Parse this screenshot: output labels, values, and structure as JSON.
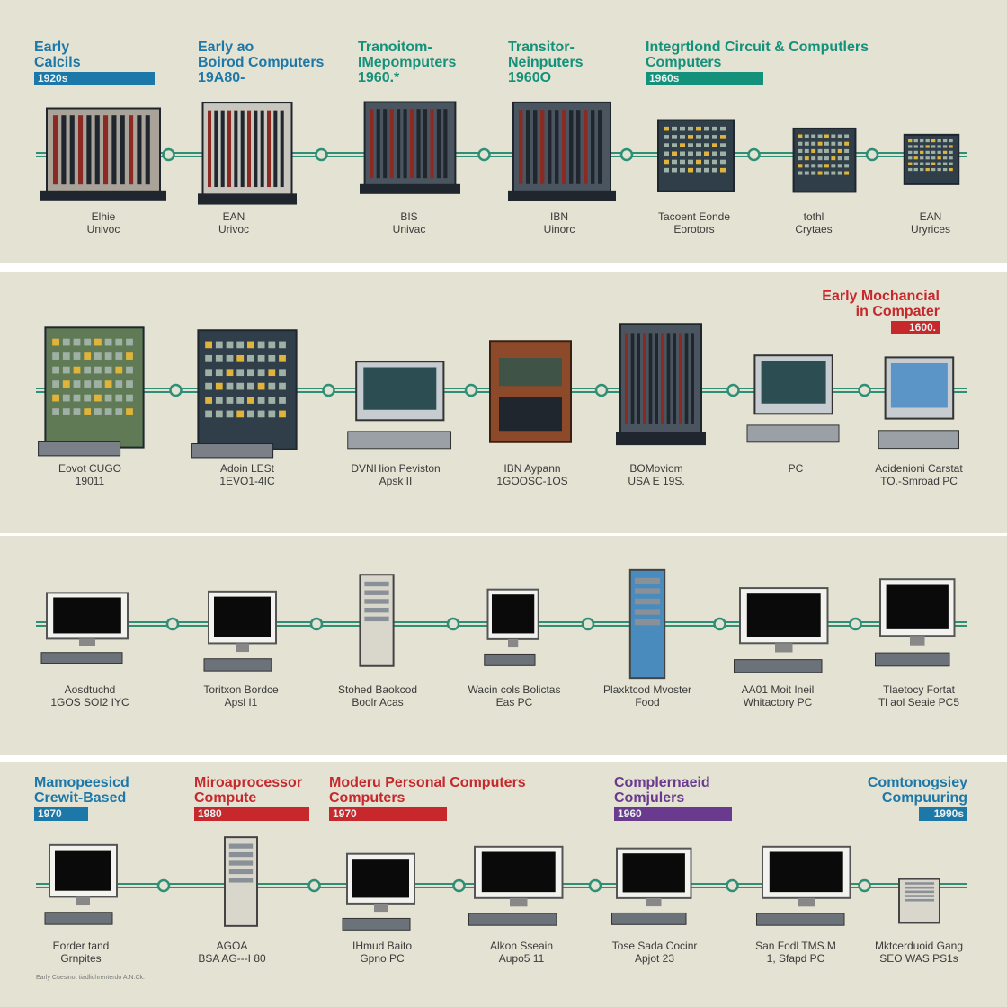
{
  "colors": {
    "background": "#e3e2d3",
    "timeline": "#2f8f76",
    "blue": "#1c78a8",
    "teal": "#14917a",
    "red": "#c6282c",
    "purple": "#6a3a8e"
  },
  "rows": [
    {
      "eras": [
        {
          "title": "Early\nCalcils",
          "badge": "1920s",
          "color": "blue"
        },
        {
          "title": "Early ao\nBoirod Computers\n19A80-",
          "badge": "",
          "color": "blue"
        },
        {
          "title": "Tranoitom-\nIMepomputers\n1960.*",
          "badge": "",
          "color": "teal"
        },
        {
          "title": "Transitor-\nNeinputers\n1960O",
          "badge": "",
          "color": "teal"
        },
        {
          "title": "Integrtlond Circuit & Computlers\nComputers",
          "badge": "1960s",
          "color": "teal"
        }
      ],
      "machines": [
        {
          "icon": "relay-rack-icon",
          "caption": "Elhie\nUnivoc"
        },
        {
          "icon": "vacuum-tube-cabinet-icon",
          "caption": "EAN\nUrivoc"
        },
        {
          "icon": "transistor-cabinet-icon",
          "caption": "BIS\nUnivac"
        },
        {
          "icon": "mainframe-cabinet-icon",
          "caption": "IBN\nUinorc"
        },
        {
          "icon": "integrated-circuit-console-icon",
          "caption": "Tacoent Eonde\nEorotors"
        },
        {
          "icon": "minicomputer-icon",
          "caption": "tothl\nCrytaes"
        },
        {
          "icon": "small-minicomputer-icon",
          "caption": "EAN\nUryrices"
        }
      ]
    },
    {
      "eras": [
        {
          "title": "Early Mochancial\nin Compater",
          "badge": "1600.",
          "color": "red",
          "align": "right"
        }
      ],
      "machines": [
        {
          "icon": "terminal-tower-icon",
          "caption": "Eovot CUGO\n19011"
        },
        {
          "icon": "workstation-tower-icon",
          "caption": "Adoin LESt\n1EVO1-4IC"
        },
        {
          "icon": "crt-terminal-icon",
          "caption": "DVNHion Peviston\nApsk II"
        },
        {
          "icon": "wooden-cabinet-icon",
          "caption": "IBN Aypann\n1GOOSC-1OS"
        },
        {
          "icon": "large-mainframe-icon",
          "caption": "BOMoviom\nUSA E 19S."
        },
        {
          "icon": "personal-computer-icon",
          "caption": "PC"
        },
        {
          "icon": "portable-computer-icon",
          "caption": "Acidenioni Carstat\nTO.-Smroad PC"
        }
      ]
    },
    {
      "eras": [],
      "machines": [
        {
          "icon": "crt-monitor-icon",
          "caption": "Aosdtuchd\n1GOS SOI2 IYC"
        },
        {
          "icon": "beige-monitor-icon",
          "caption": "Toritxon Bordce\nApsl I1"
        },
        {
          "icon": "beige-tower-icon",
          "caption": "Stohed Baokcod\nBoolr Acas"
        },
        {
          "icon": "all-in-one-mac-icon",
          "caption": "Wacin cols Bolictas\nEas PC"
        },
        {
          "icon": "blue-tower-icon",
          "caption": "Plaxktcod Mvoster\nFood"
        },
        {
          "icon": "flat-monitor-icon",
          "caption": "AA01 Moit Ineil\nWhitactory PC"
        },
        {
          "icon": "desktop-set-icon",
          "caption": "Tlaetocy Fortat\nTl aol Seaie PC5"
        }
      ]
    },
    {
      "eras": [
        {
          "title": "Mamopeesicd\nCrewit-Based",
          "badge": "1970",
          "color": "blue"
        },
        {
          "title": "Miroaprocessor\nCompute",
          "badge": "1980",
          "color": "red"
        },
        {
          "title": "Moderu Personal Computers\nComputers",
          "badge": "1970",
          "color": "red"
        },
        {
          "title": "Complernaeid\nComjulers",
          "badge": "1960",
          "color": "purple"
        },
        {
          "title": "Comtonogsiey\nCompuuring",
          "badge": "1990s",
          "color": "blue",
          "align": "right"
        }
      ],
      "machines": [
        {
          "icon": "desktop-with-printer-icon",
          "caption": "Eorder tand\nGrnpites"
        },
        {
          "icon": "pc-tower-icon",
          "caption": "AGOA\nBSA AG---I 80"
        },
        {
          "icon": "compact-mac-icon",
          "caption": "IHmud Baito\nGpno PC"
        },
        {
          "icon": "imac-icon",
          "caption": "Alkon Sseain\nAupo5 11"
        },
        {
          "icon": "lcd-desktop-icon",
          "caption": "Tose Sada Cocinr\nApjot 23"
        },
        {
          "icon": "widescreen-desktop-icon",
          "caption": "San Fodl TMS.M\n1, Sfapd PC"
        },
        {
          "icon": "modern-desktop-tower-icon",
          "caption": "Mktcerduoid Gang\nSEO WAS PS1s"
        }
      ]
    }
  ],
  "footnote": "Early Cuesinot tiadlichrenterdo A.N.Ck."
}
